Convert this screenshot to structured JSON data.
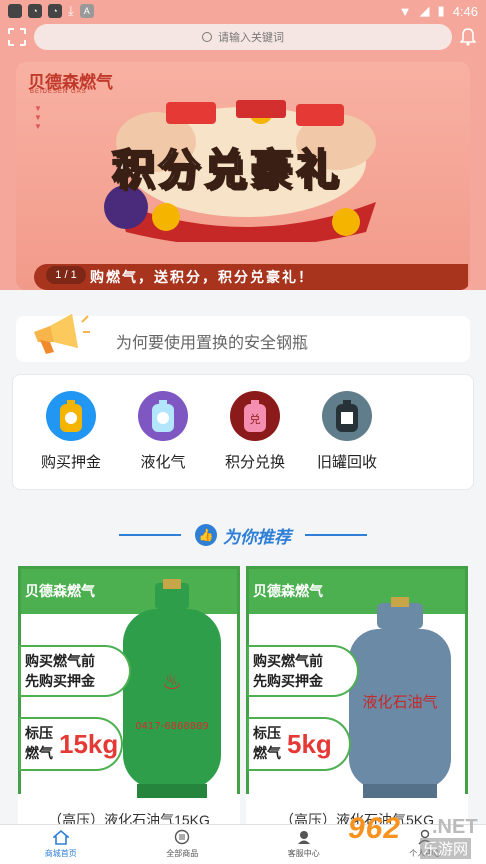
{
  "status_bar": {
    "time": "4:46"
  },
  "search": {
    "placeholder": "请输入关键词"
  },
  "banner": {
    "brand": "贝德森燃气",
    "brand_en": "BEIDESEN GAS",
    "headline": "积分兑豪礼",
    "counter": "1 / 1",
    "tagline": "购燃气，送积分，积分兑豪礼！"
  },
  "notice": {
    "text": "为何要使用置换的安全钢瓶"
  },
  "categories": [
    {
      "label": "购买押金",
      "color": "#2196f3"
    },
    {
      "label": "液化气",
      "color": "#7e57c2"
    },
    {
      "label": "积分兑换",
      "color": "#8b1a1a"
    },
    {
      "label": "旧罐回收",
      "color": "#607d8b"
    }
  ],
  "recommend": {
    "title": "为你推荐"
  },
  "products": [
    {
      "brand": "贝德森燃气",
      "promo_line1": "购买燃气前",
      "promo_line2": "先购买押金",
      "pressure": "标压燃气",
      "weight": "15kg",
      "tank_color": "#2e9e4a",
      "tank_text": "0417-6868889",
      "name": "（高压）液化石油气15KG"
    },
    {
      "brand": "贝德森燃气",
      "promo_line1": "购买燃气前",
      "promo_line2": "先购买押金",
      "pressure": "标压燃气",
      "weight": "5kg",
      "tank_color": "#6b8aa6",
      "tank_text": "液化石油气",
      "name": "（高压）液化石油气5KG"
    }
  ],
  "bottom_nav": [
    {
      "label": "商城首页",
      "icon": "home-icon",
      "active": true
    },
    {
      "label": "全部商品",
      "icon": "grid-icon",
      "active": false
    },
    {
      "label": "客服中心",
      "icon": "service-icon",
      "active": false
    },
    {
      "label": "个人中心",
      "icon": "user-icon",
      "active": false
    }
  ],
  "watermark": {
    "number": "962",
    "net": ".NET",
    "cn": "乐游网"
  }
}
